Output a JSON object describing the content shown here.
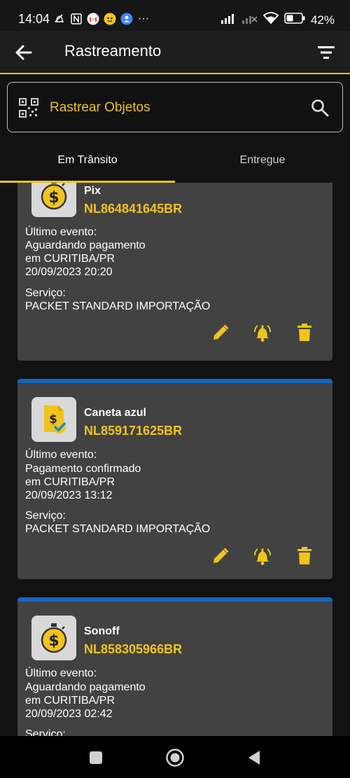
{
  "status_bar": {
    "time": "14:04",
    "battery_percent": "42%",
    "more_label": "···"
  },
  "app_bar": {
    "title": "Rastreamento"
  },
  "search": {
    "placeholder": "Rastrear Objetos"
  },
  "tabs": [
    {
      "label": "Em Trânsito",
      "selected": true
    },
    {
      "label": "Entregue",
      "selected": false
    }
  ],
  "packages": [
    {
      "name": "Pix",
      "code": "NL864841645BR",
      "icon": "money-timer-icon",
      "last_event_label": "Último evento:",
      "event": "Aguardando pagamento",
      "location": "em CURITIBA/PR",
      "datetime": "20/09/2023 20:20",
      "service_label": "Serviço:",
      "service": "PACKET STANDARD IMPORTAÇÃO"
    },
    {
      "name": "Caneta azul",
      "code": "NL859171625BR",
      "icon": "payment-confirmed-icon",
      "last_event_label": "Último evento:",
      "event": "Pagamento confirmado",
      "location": "em CURITIBA/PR",
      "datetime": "20/09/2023 13:12",
      "service_label": "Serviço:",
      "service": "PACKET STANDARD IMPORTAÇÃO"
    },
    {
      "name": "Sonoff",
      "code": "NL858305966BR",
      "icon": "money-timer-icon",
      "last_event_label": "Último evento:",
      "event": "Aguardando pagamento",
      "location": "em CURITIBA/PR",
      "datetime": "20/09/2023 02:42",
      "service_label": "Serviço:"
    }
  ],
  "colors": {
    "accent": "#f0c419",
    "card_bg": "#424242",
    "card_top_bar": "#1565c0",
    "background": "#121212"
  }
}
